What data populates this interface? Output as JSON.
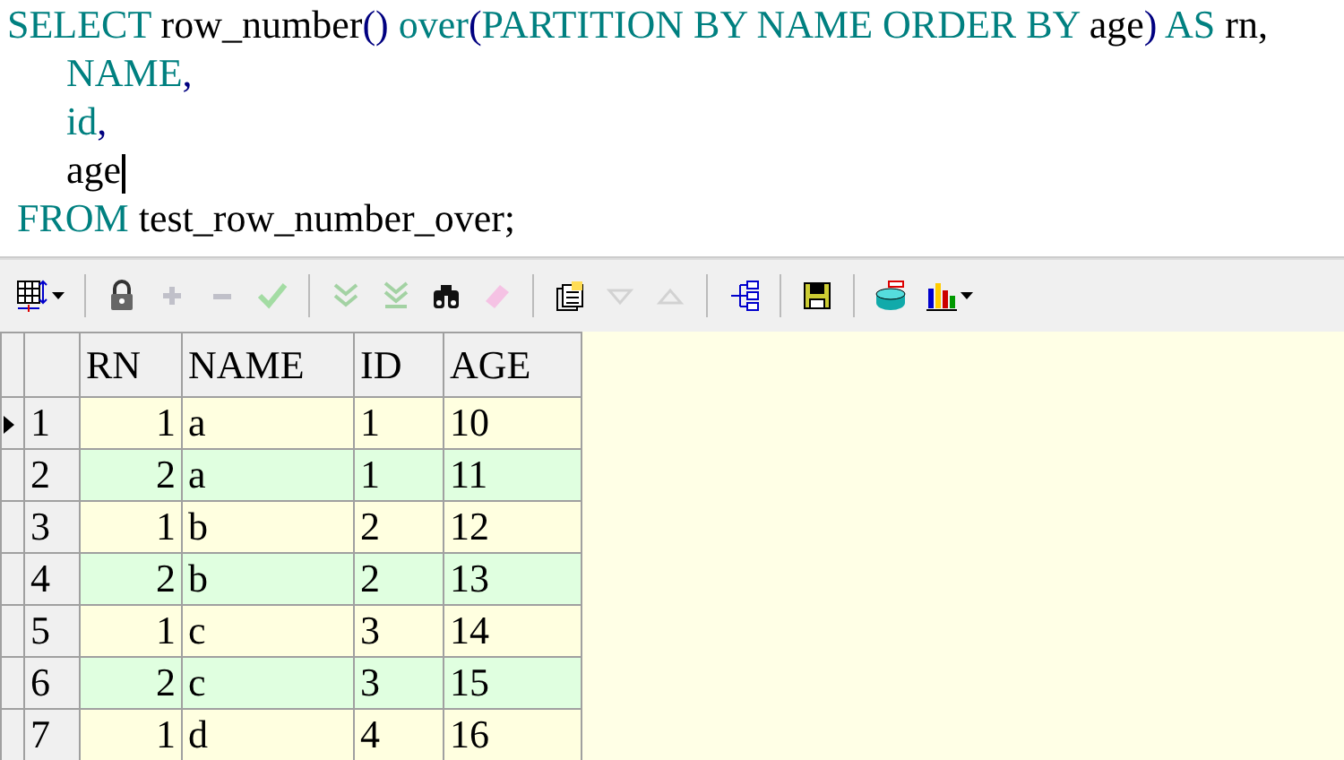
{
  "editor": {
    "lines": [
      {
        "tokens": [
          {
            "kind": "keyword",
            "text": "SELECT"
          },
          {
            "kind": "plain",
            "text": " row_number"
          },
          {
            "kind": "punct",
            "text": "()"
          },
          {
            "kind": "keyword",
            "text": " over"
          },
          {
            "kind": "punct",
            "text": "("
          },
          {
            "kind": "keyword",
            "text": "PARTITION BY NAME ORDER BY"
          },
          {
            "kind": "plain",
            "text": " age"
          },
          {
            "kind": "punct",
            "text": ")"
          },
          {
            "kind": "keyword",
            "text": " AS"
          },
          {
            "kind": "plain",
            "text": " rn,"
          }
        ]
      },
      {
        "tokens": [
          {
            "kind": "keyword",
            "text": "      NAME"
          },
          {
            "kind": "punct",
            "text": ","
          }
        ]
      },
      {
        "tokens": [
          {
            "kind": "keyword",
            "text": "      id"
          },
          {
            "kind": "punct",
            "text": ","
          }
        ]
      },
      {
        "tokens": [
          {
            "kind": "plain",
            "text": "      age"
          },
          {
            "kind": "caret"
          }
        ]
      },
      {
        "tokens": [
          {
            "kind": "keyword",
            "text": " FROM"
          },
          {
            "kind": "plain",
            "text": " test_row_number_over;"
          }
        ]
      }
    ]
  },
  "toolbar": [
    {
      "kind": "grid",
      "disabled": false,
      "dropdown": true
    },
    {
      "kind": "sep"
    },
    {
      "kind": "lock",
      "disabled": false
    },
    {
      "kind": "plus",
      "disabled": true
    },
    {
      "kind": "minus",
      "disabled": true
    },
    {
      "kind": "check",
      "disabled": true
    },
    {
      "kind": "sep"
    },
    {
      "kind": "down-chevrons",
      "disabled": true
    },
    {
      "kind": "down-chevrons-bar",
      "disabled": true
    },
    {
      "kind": "binoculars",
      "disabled": false
    },
    {
      "kind": "eraser",
      "disabled": true
    },
    {
      "kind": "sep"
    },
    {
      "kind": "pages",
      "disabled": false
    },
    {
      "kind": "down-triangle",
      "disabled": true
    },
    {
      "kind": "up-triangle",
      "disabled": true
    },
    {
      "kind": "sep"
    },
    {
      "kind": "tree",
      "disabled": false
    },
    {
      "kind": "sep"
    },
    {
      "kind": "floppy",
      "disabled": false
    },
    {
      "kind": "sep"
    },
    {
      "kind": "database",
      "disabled": false
    },
    {
      "kind": "bar-chart",
      "disabled": false,
      "dropdown": true
    }
  ],
  "table": {
    "columns": [
      "RN",
      "NAME",
      "ID",
      "AGE"
    ],
    "rows": [
      {
        "number": "1",
        "selected": true,
        "cells": [
          "1",
          "a",
          "1",
          "10"
        ]
      },
      {
        "number": "2",
        "selected": false,
        "cells": [
          "2",
          "a",
          "1",
          "11"
        ]
      },
      {
        "number": "3",
        "selected": false,
        "cells": [
          "1",
          "b",
          "2",
          "12"
        ]
      },
      {
        "number": "4",
        "selected": false,
        "cells": [
          "2",
          "b",
          "2",
          "13"
        ]
      },
      {
        "number": "5",
        "selected": false,
        "cells": [
          "1",
          "c",
          "3",
          "14"
        ]
      },
      {
        "number": "6",
        "selected": false,
        "cells": [
          "2",
          "c",
          "3",
          "15"
        ]
      },
      {
        "number": "7",
        "selected": false,
        "cells": [
          "1",
          "d",
          "4",
          "16"
        ]
      }
    ]
  }
}
